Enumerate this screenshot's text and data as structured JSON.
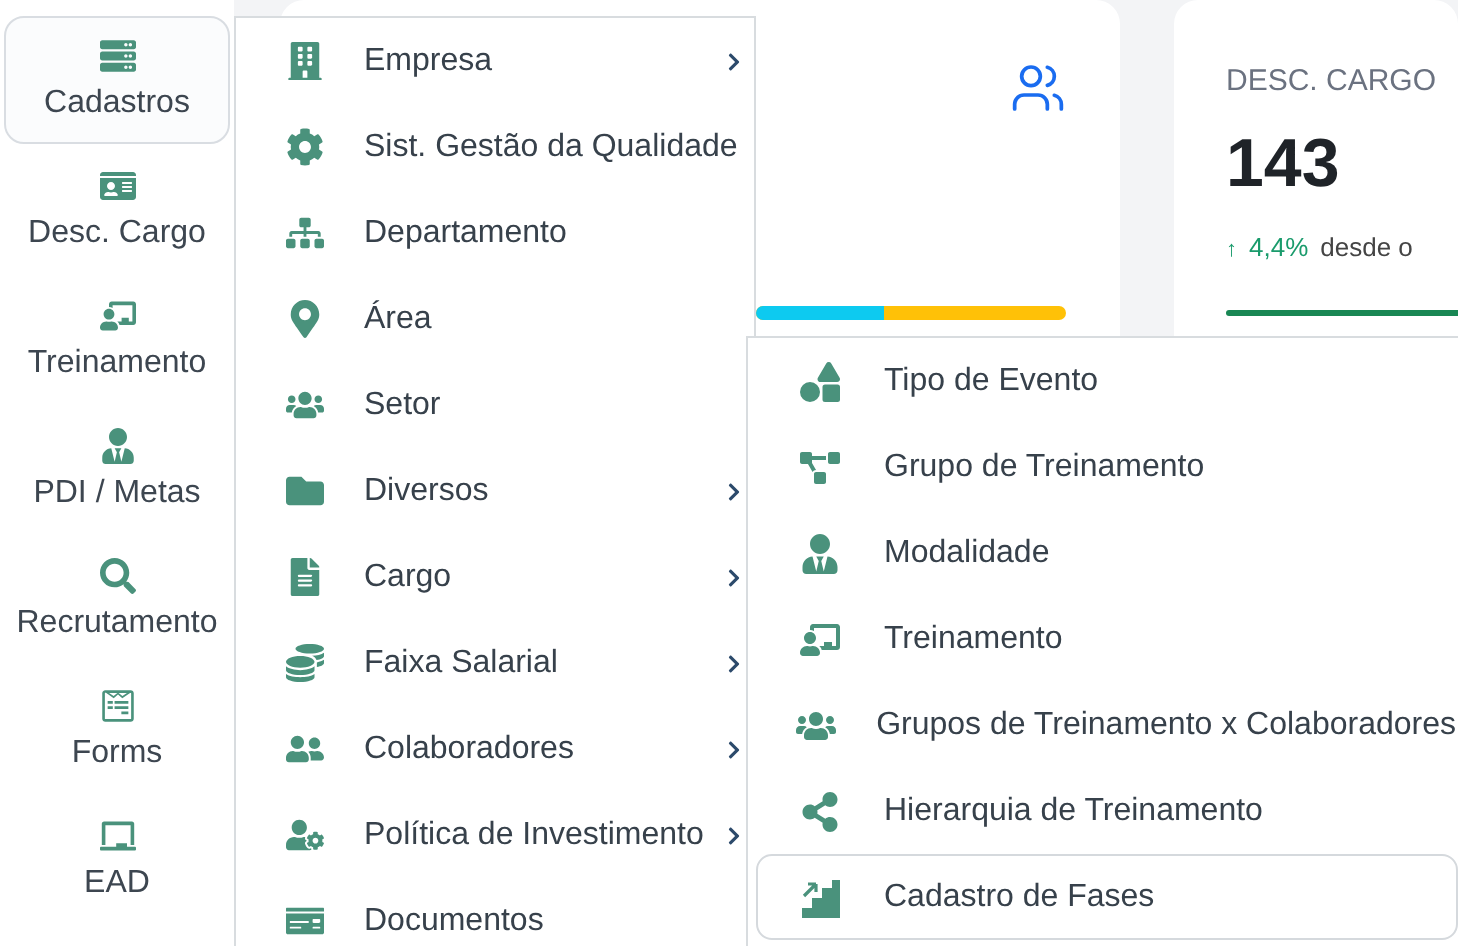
{
  "sidebar": {
    "items": [
      {
        "label": "Cadastros",
        "selected": true
      },
      {
        "label": "Desc. Cargo",
        "selected": false
      },
      {
        "label": "Treinamento",
        "selected": false
      },
      {
        "label": "PDI / Metas",
        "selected": false
      },
      {
        "label": "Recrutamento",
        "selected": false
      },
      {
        "label": "Forms",
        "selected": false
      },
      {
        "label": "EAD",
        "selected": false
      }
    ]
  },
  "cards": [
    {
      "level": 0.41
    },
    {
      "title": "DESC. CARGO",
      "value": "143",
      "trend": "↑",
      "change": "4,4%",
      "caption": "desde o"
    }
  ],
  "menu": {
    "items": [
      {
        "label": "Empresa",
        "has_submenu": true
      },
      {
        "label": "Sist. Gestão da Qualidade",
        "has_submenu": false
      },
      {
        "label": "Departamento",
        "has_submenu": false
      },
      {
        "label": "Área",
        "has_submenu": false
      },
      {
        "label": "Setor",
        "has_submenu": false
      },
      {
        "label": "Diversos",
        "has_submenu": true
      },
      {
        "label": "Cargo",
        "has_submenu": true
      },
      {
        "label": "Faixa Salarial",
        "has_submenu": true
      },
      {
        "label": "Colaboradores",
        "has_submenu": true
      },
      {
        "label": "Política de Investimento",
        "has_submenu": true
      },
      {
        "label": "Documentos",
        "has_submenu": false
      }
    ]
  },
  "submenu": {
    "items": [
      {
        "label": "Tipo de Evento",
        "selected": false
      },
      {
        "label": "Grupo de Treinamento",
        "selected": false
      },
      {
        "label": "Modalidade",
        "selected": false
      },
      {
        "label": "Treinamento",
        "selected": false
      },
      {
        "label": "Grupos de Treinamento x Colaboradores",
        "selected": false
      },
      {
        "label": "Hierarquia de Treinamento",
        "selected": false
      },
      {
        "label": "Cadastro de Fases",
        "selected": true
      }
    ]
  }
}
